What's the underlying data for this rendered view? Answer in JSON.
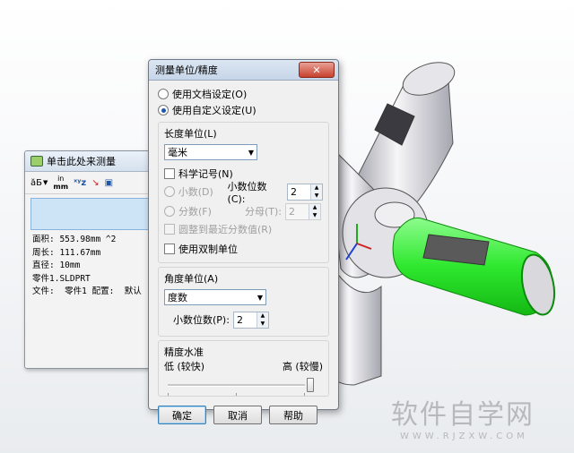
{
  "measure_window": {
    "title": "单击此处来测量",
    "toolbar_items": [
      "abc-units-icon",
      "mm-units-icon",
      "xyz-icon",
      "point-to-point-icon",
      "history-icon"
    ],
    "toolbar_unit_top": "in",
    "toolbar_unit_bottom": "mm",
    "results": [
      "面积: 553.98mm ^2",
      "周长: 111.67mm",
      "直径: 10mm",
      "零件1.SLDPRT",
      "文件:  零件1 配置:  默认"
    ]
  },
  "dialog": {
    "title": "测量单位/精度",
    "close_label": "✕",
    "radio_doc": "使用文档设定(O)",
    "radio_custom": "使用自定义设定(U)",
    "length_group": {
      "label": "长度单位(L)",
      "unit_value": "毫米",
      "sci_notation": "科学记号(N)",
      "decimal": "小数(D)",
      "decimal_places_label": "小数位数(C):",
      "decimal_places_value": "2",
      "fraction": "分数(F)",
      "denominator_label": "分母(T):",
      "denominator_value": "2",
      "round_fraction": "圆整到最近分数值(R)",
      "dual_units": "使用双制单位"
    },
    "angle_group": {
      "label": "角度单位(A)",
      "unit_value": "度数",
      "decimal_places_label": "小数位数(P):",
      "decimal_places_value": "2"
    },
    "precision": {
      "label": "精度水准",
      "low": "低 (较快)",
      "high": "高 (较慢)",
      "level": 1.0
    },
    "buttons": {
      "ok": "确定",
      "cancel": "取消",
      "help": "帮助"
    }
  },
  "watermark": {
    "text": "软件自学网",
    "url": "WWW.RJZXW.COM"
  },
  "colors": {
    "selection_green": "#3df03d",
    "model_gray": "#d9d9de",
    "title_bar": "#d0dceb"
  }
}
